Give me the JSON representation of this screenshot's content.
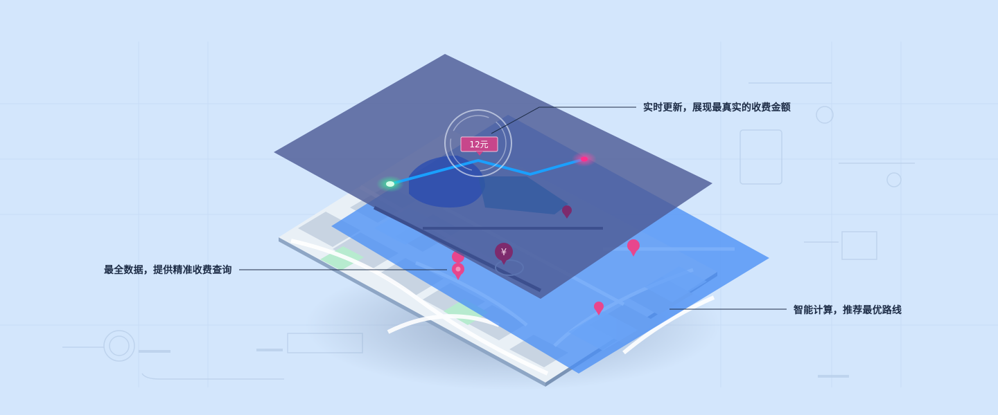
{
  "price_tag": "12元",
  "yen_marker": "¥",
  "callouts": {
    "top": "实时更新，展现最真实的收费金额",
    "left": "最全数据，提供精准收费查询",
    "right": "智能计算，推荐最优路线"
  },
  "colors": {
    "background": "#d3e6fc",
    "top_layer": "#4e5c96",
    "mid_layer": "#4c8ff5",
    "map_base": "#e9f0f6",
    "route": "#1aa0ff",
    "start_dot": "#2fe08a",
    "pin": "#e8468d",
    "tag": "#c7468b"
  }
}
